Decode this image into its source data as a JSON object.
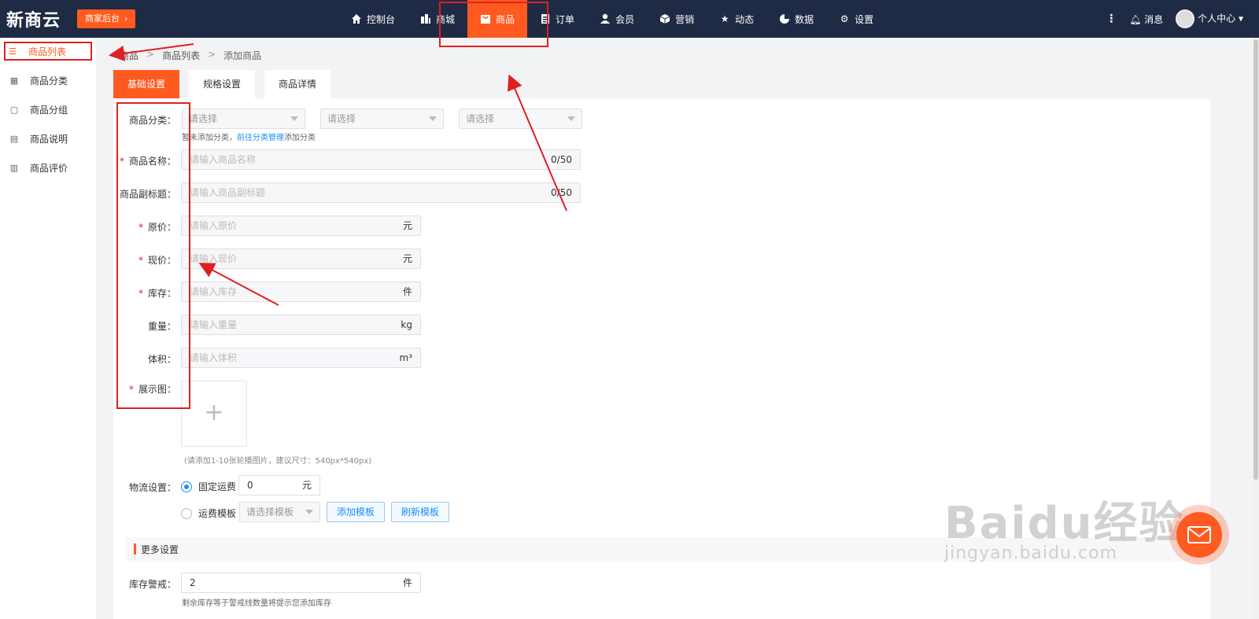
{
  "topbar": {
    "brand": "新商云",
    "badge": "商家后台",
    "nav": [
      {
        "icon": "home-icon",
        "label": "控制台"
      },
      {
        "icon": "store-icon",
        "label": "商城"
      },
      {
        "icon": "bag-icon",
        "label": "商品"
      },
      {
        "icon": "order-icon",
        "label": "订单"
      },
      {
        "icon": "user-icon",
        "label": "会员"
      },
      {
        "icon": "box-icon",
        "label": "营销"
      },
      {
        "icon": "star-icon",
        "label": "动态"
      },
      {
        "icon": "pie-chart-icon",
        "label": "数据"
      },
      {
        "icon": "gear-icon",
        "label": "设置"
      }
    ],
    "active_nav": "商品",
    "messages_label": "消息",
    "profile_label": "个人中心"
  },
  "sidebar": {
    "items": [
      {
        "icon": "list-icon",
        "label": "商品列表"
      },
      {
        "icon": "grid-icon",
        "label": "商品分类"
      },
      {
        "icon": "group-icon",
        "label": "商品分组"
      },
      {
        "icon": "doc-icon",
        "label": "商品说明"
      },
      {
        "icon": "review-icon",
        "label": "商品评价"
      }
    ]
  },
  "breadcrumb": [
    "商品",
    "商品列表",
    "添加商品"
  ],
  "tabs": [
    "基础设置",
    "规格设置",
    "商品详情"
  ],
  "form": {
    "category": {
      "label": "商品分类：",
      "select1": "请选择",
      "select2": "请选择",
      "select3": "请选择",
      "hint_prefix": "暂未添加分类，",
      "hint_link": "前往分类管理",
      "hint_suffix": "添加分类"
    },
    "name": {
      "label": "商品名称：",
      "placeholder": "请输入商品名称",
      "counter": "0/50"
    },
    "subtitle": {
      "label": "商品副标题：",
      "placeholder": "请输入商品副标题",
      "counter": "0/50"
    },
    "original_price": {
      "label": "原价：",
      "placeholder": "请输入原价",
      "unit": "元"
    },
    "current_price": {
      "label": "现价：",
      "placeholder": "请输入现价",
      "unit": "元"
    },
    "stock": {
      "label": "库存：",
      "placeholder": "请输入库存",
      "unit": "件"
    },
    "weight": {
      "label": "重量：",
      "placeholder": "请输入重量",
      "unit": "kg"
    },
    "volume": {
      "label": "体积：",
      "placeholder": "请输入体积",
      "unit": "m³"
    },
    "images": {
      "label": "展示图：",
      "hint": "(请添加1-10张轮播图片，建议尺寸：540px*540px)"
    },
    "logistics": {
      "label": "物流设置：",
      "fixed_label": "固定运费",
      "fixed_value": "0",
      "fixed_unit": "元",
      "template_label": "运费模板",
      "template_select": "请选择模板",
      "add_template": "添加模板",
      "refresh_template": "刷新模板"
    },
    "more": {
      "title": "更多设置"
    },
    "stock_warning": {
      "label": "库存警戒：",
      "value": "2",
      "unit": "件",
      "hint": "剩余库存等于警戒线数量将提示您添加库存"
    }
  },
  "watermark": {
    "big": "Baidu经验",
    "small": "jingyan.baidu.com"
  },
  "colors": {
    "accent": "#ff5a1f",
    "topbar": "#1f2a44",
    "link": "#1890ff",
    "annotation": "#e02020"
  }
}
